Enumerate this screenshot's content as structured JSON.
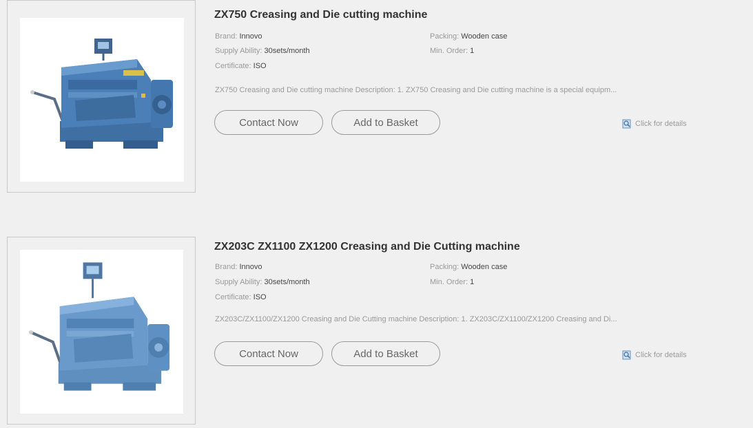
{
  "products": [
    {
      "title": "ZX750 Creasing and Die cutting machine",
      "brand_label": "Brand: ",
      "brand_value": "Innovo",
      "supply_label": "Supply Ability: ",
      "supply_value": "30sets/month",
      "cert_label": "Certificate: ",
      "cert_value": "ISO",
      "packing_label": "Packing: ",
      "packing_value": "Wooden case",
      "minorder_label": "Min. Order: ",
      "minorder_value": "1",
      "description": "ZX750 Creasing and Die cutting machine Description: 1. ZX750 Creasing and Die cutting machine is a special equipm...",
      "contact_label": "Contact Now",
      "basket_label": "Add to Basket",
      "details_label": "Click for details"
    },
    {
      "title": "ZX203C ZX1100 ZX1200 Creasing and Die Cutting machine",
      "brand_label": "Brand: ",
      "brand_value": "Innovo",
      "supply_label": "Supply Ability: ",
      "supply_value": "30sets/month",
      "cert_label": "Certificate: ",
      "cert_value": "ISO",
      "packing_label": "Packing: ",
      "packing_value": "Wooden case",
      "minorder_label": "Min. Order: ",
      "minorder_value": "1",
      "description": "ZX203C/ZX1100/ZX1200 Creasing and Die Cutting machine Description: 1. ZX203C/ZX1100/ZX1200 Creasing and Di...",
      "contact_label": "Contact Now",
      "basket_label": "Add to Basket",
      "details_label": "Click for details"
    }
  ],
  "colors": {
    "background": "#f0f0f0",
    "machine_blue": "#4a7fb8",
    "text_muted": "#999999"
  },
  "icons": {
    "details": "magnifier-document-icon",
    "product_image": "die-cutting-machine-image"
  }
}
